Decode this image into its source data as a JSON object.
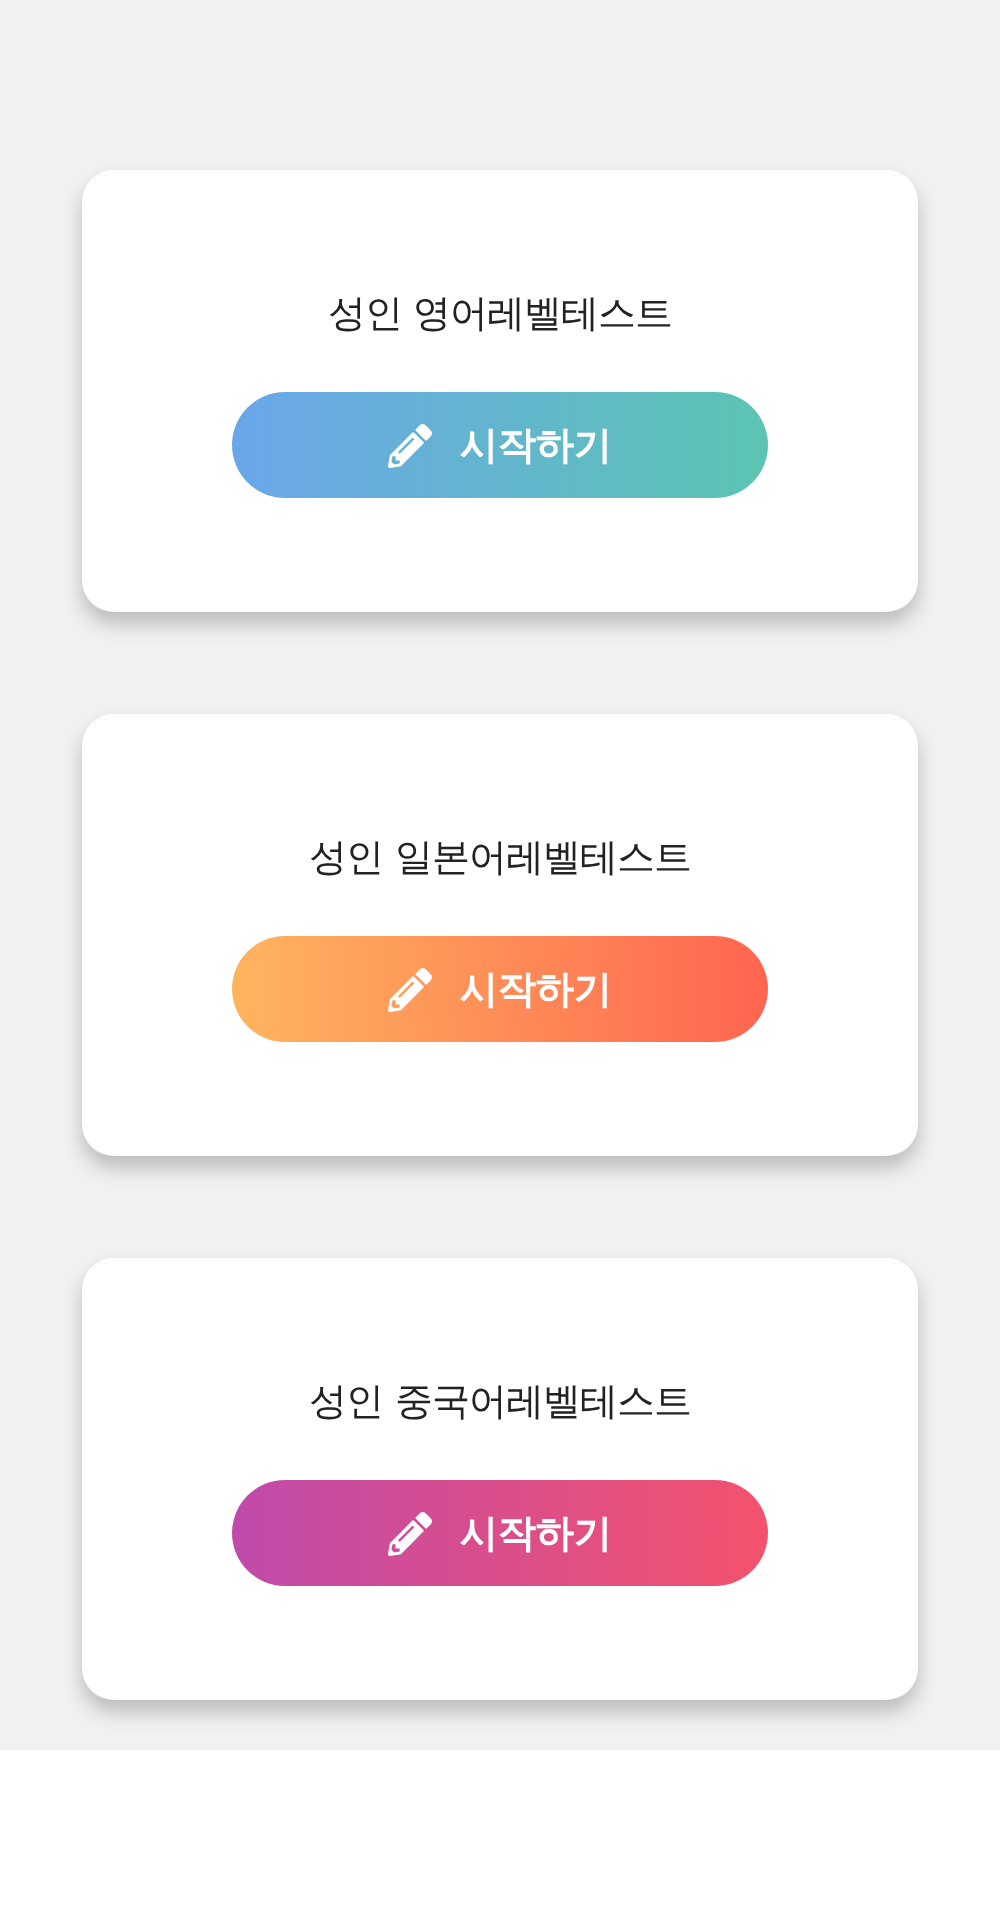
{
  "cards": [
    {
      "title": "성인 영어레벨테스트",
      "button": "시작하기",
      "kind": "blue",
      "color": "#6aa6ea"
    },
    {
      "title": "성인 일본어레벨테스트",
      "button": "시작하기",
      "kind": "orange",
      "color": "#feb55f"
    },
    {
      "title": "성인 중국어레벨테스트",
      "button": "시작하기",
      "kind": "pink",
      "color": "#c04aaa"
    }
  ]
}
